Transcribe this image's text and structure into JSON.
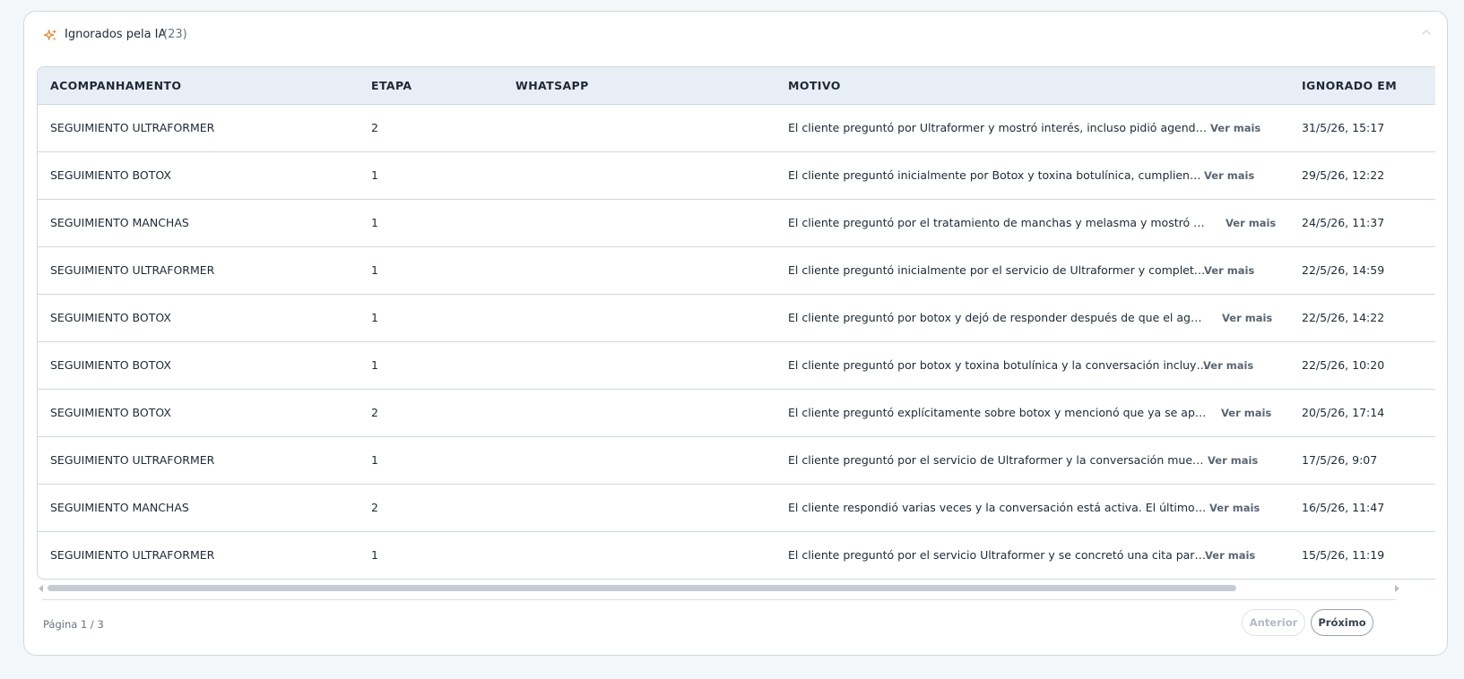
{
  "panel": {
    "title": "Ignorados pela IA",
    "count": "(23)",
    "accent_color": "#e8832a"
  },
  "table": {
    "columns": [
      "ACOMPANHAMENTO",
      "ETAPA",
      "WHATSAPP",
      "MOTIVO",
      "IGNORADO EM"
    ],
    "rows": [
      {
        "acompanhamento": "SEGUIMIENTO ULTRAFORMER",
        "etapa": "2",
        "whatsapp": "",
        "motivo": "El cliente preguntó por Ultraformer y mostró interés, incluso pidió agendar para...",
        "ver_mais": "Ver mais",
        "ignorado_em": "31/5/26, 15:17"
      },
      {
        "acompanhamento": "SEGUIMIENTO BOTOX",
        "etapa": "1",
        "whatsapp": "",
        "motivo": "El cliente preguntó inicialmente por Botox y toxina botulínica, cumpliendo la in...",
        "ver_mais": "Ver mais",
        "ignorado_em": "29/5/26, 12:22"
      },
      {
        "acompanhamento": "SEGUIMIENTO MANCHAS",
        "etapa": "1",
        "whatsapp": "",
        "motivo": "El cliente preguntó por el tratamiento de manchas y melasma y mostró interés en ...",
        "ver_mais": "Ver mais",
        "ignorado_em": "24/5/26, 11:37"
      },
      {
        "acompanhamento": "SEGUIMIENTO ULTRAFORMER",
        "etapa": "1",
        "whatsapp": "",
        "motivo": "El cliente preguntó inicialmente por el servicio de Ultraformer y completó la re...",
        "ver_mais": "Ver mais",
        "ignorado_em": "22/5/26, 14:59"
      },
      {
        "acompanhamento": "SEGUIMIENTO BOTOX",
        "etapa": "1",
        "whatsapp": "",
        "motivo": "El cliente preguntó por botox y dejó de responder después de que el agente solic...",
        "ver_mais": "Ver mais",
        "ignorado_em": "22/5/26, 14:22"
      },
      {
        "acompanhamento": "SEGUIMIENTO BOTOX",
        "etapa": "1",
        "whatsapp": "",
        "motivo": "El cliente preguntó por botox y toxina botulínica y la conversación incluye info...",
        "ver_mais": "Ver mais",
        "ignorado_em": "22/5/26, 10:20"
      },
      {
        "acompanhamento": "SEGUIMIENTO BOTOX",
        "etapa": "2",
        "whatsapp": "",
        "motivo": "El cliente preguntó explícitamente sobre botox y mencionó que ya se aplicó toxin...",
        "ver_mais": "Ver mais",
        "ignorado_em": "20/5/26, 17:14"
      },
      {
        "acompanhamento": "SEGUIMIENTO ULTRAFORMER",
        "etapa": "1",
        "whatsapp": "",
        "motivo": "El cliente preguntó por el servicio de Ultraformer y la conversación muestra int...",
        "ver_mais": "Ver mais",
        "ignorado_em": "17/5/26, 9:07"
      },
      {
        "acompanhamento": "SEGUIMIENTO MANCHAS",
        "etapa": "2",
        "whatsapp": "",
        "motivo": "El cliente respondió varias veces y la conversación está activa. El último mensa...",
        "ver_mais": "Ver mais",
        "ignorado_em": "16/5/26, 11:47"
      },
      {
        "acompanhamento": "SEGUIMIENTO ULTRAFORMER",
        "etapa": "1",
        "whatsapp": "",
        "motivo": "El cliente preguntó por el servicio Ultraformer y se concretó una cita para ese ...",
        "ver_mais": "Ver mais",
        "ignorado_em": "15/5/26, 11:19"
      }
    ],
    "horizontal_scroll_fraction": 0.89
  },
  "pagination": {
    "page_info": "Página 1 / 3",
    "prev_label": "Anterior",
    "next_label": "Próximo"
  },
  "icons": {
    "panel_icon": "sparkle-icon",
    "collapse": "chevron-up-icon"
  }
}
